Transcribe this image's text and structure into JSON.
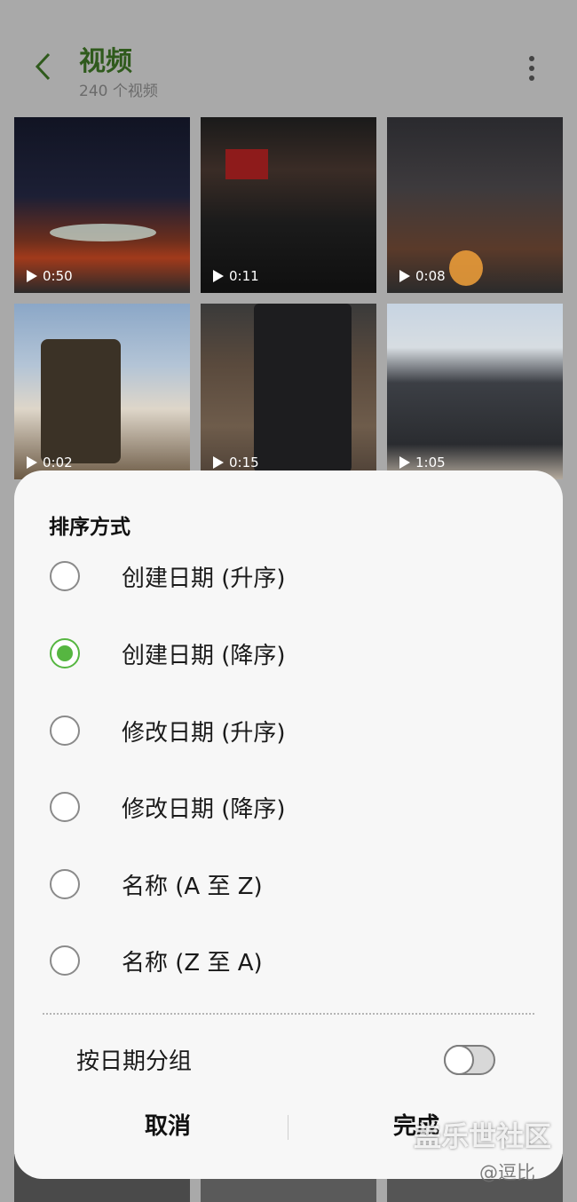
{
  "header": {
    "title": "视频",
    "subtitle": "240 个视频",
    "back_icon": "chevron-left-icon",
    "more_icon": "more-vertical-icon"
  },
  "videos": [
    {
      "duration": "0:50"
    },
    {
      "duration": "0:11"
    },
    {
      "duration": "0:08"
    },
    {
      "duration": "0:02"
    },
    {
      "duration": "0:15"
    },
    {
      "duration": "1:05"
    }
  ],
  "sort_dialog": {
    "title": "排序方式",
    "options": [
      {
        "label": "创建日期 (升序)",
        "selected": false
      },
      {
        "label": "创建日期 (降序)",
        "selected": true
      },
      {
        "label": "修改日期 (升序)",
        "selected": false
      },
      {
        "label": "修改日期 (降序)",
        "selected": false
      },
      {
        "label": "名称 (A 至 Z)",
        "selected": false
      },
      {
        "label": "名称 (Z 至 A)",
        "selected": false
      }
    ],
    "group_by_date_label": "按日期分组",
    "group_by_date_enabled": false,
    "cancel_label": "取消",
    "done_label": "完成"
  },
  "watermark": {
    "text": "盖乐世社区",
    "sub": "@逗比"
  },
  "colors": {
    "accent": "#56b641",
    "title": "#2f5a1c"
  }
}
